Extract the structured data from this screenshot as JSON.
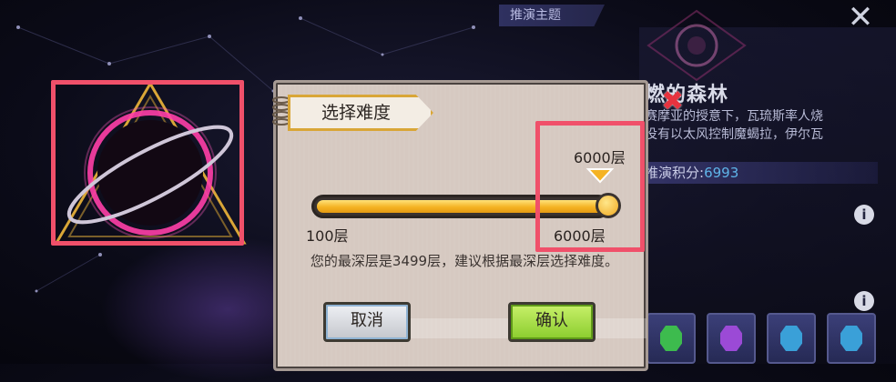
{
  "theme": {
    "tab_label": "推演主题",
    "title_suffix": "燃",
    "title": "的森林",
    "description": "赛摩亚的授意下，瓦琉斯率人烧\n没有以太风控制魔蝎拉，伊尔瓦",
    "score_label": "推演积分:",
    "score_value": "6993"
  },
  "dialog": {
    "title": "选择难度",
    "max_marker_label": "6000层",
    "slider": {
      "min_label": "100层",
      "max_label": "6000层",
      "min": 100,
      "max": 6000,
      "value": 6000
    },
    "hint": "您的最深层是3499层，建议根据最深层选择难度。",
    "cancel_label": "取消",
    "confirm_label": "确认"
  },
  "icons": {
    "close": "close-icon",
    "info": "info-icon",
    "red_x": "red-x-mark-icon"
  },
  "colors": {
    "highlight": "#f0506a",
    "slider_fill": "#f5b323",
    "confirm": "#8acc2d",
    "score": "#5fb4e8"
  }
}
